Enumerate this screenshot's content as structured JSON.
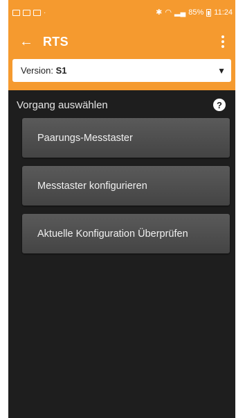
{
  "status_bar": {
    "time": "11:24",
    "battery": "85%",
    "icons": [
      "gallery-icon",
      "notification-icon",
      "image-icon",
      "bluetooth-icon",
      "wifi-icon",
      "signal-icon",
      "battery-icon"
    ]
  },
  "app_bar": {
    "title": "RTS",
    "back_icon": "arrow-left-icon",
    "menu_icon": "more-vert-icon"
  },
  "version_selector": {
    "label": "Version: ",
    "value": "S1"
  },
  "section": {
    "title": "Vorgang auswählen",
    "help_label": "?"
  },
  "actions": [
    {
      "label": "Paarungs-Messtaster"
    },
    {
      "label": "Messtaster konfigurieren"
    },
    {
      "label": "Aktuelle Konfiguration Überprüfen"
    }
  ],
  "colors": {
    "accent": "#f59a2f",
    "background": "#1e1e1e",
    "button": "#4f4f4f"
  }
}
